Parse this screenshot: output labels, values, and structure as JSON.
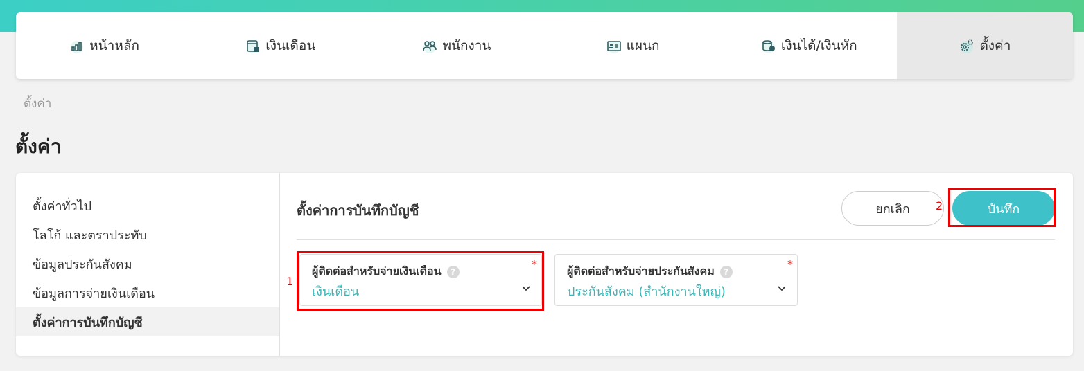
{
  "nav": {
    "items": [
      {
        "label": "หน้าหลัก",
        "icon": "bar-chart-icon"
      },
      {
        "label": "เงินเดือน",
        "icon": "calendar-icon"
      },
      {
        "label": "พนักงาน",
        "icon": "users-icon"
      },
      {
        "label": "แผนก",
        "icon": "id-card-icon"
      },
      {
        "label": "เงินได้/เงินหัก",
        "icon": "money-icon"
      },
      {
        "label": "ตั้งค่า",
        "icon": "gear-icon"
      }
    ]
  },
  "breadcrumb": "ตั้งค่า",
  "page_title": "ตั้งค่า",
  "sidebar": {
    "items": [
      {
        "label": "ตั้งค่าทั่วไป"
      },
      {
        "label": "โลโก้ และตราประทับ"
      },
      {
        "label": "ข้อมูลประกันสังคม"
      },
      {
        "label": "ข้อมูลการจ่ายเงินเดือน"
      },
      {
        "label": "ตั้งค่าการบันทึกบัญชี"
      }
    ]
  },
  "main": {
    "title": "ตั้งค่าการบันทึกบัญชี",
    "cancel_label": "ยกเลิก",
    "save_label": "บันทึก",
    "fields": [
      {
        "label": "ผู้ติดต่อสำหรับจ่ายเงินเดือน",
        "value": "เงินเดือน",
        "required": "*",
        "help": "?"
      },
      {
        "label": "ผู้ติดต่อสำหรับจ่ายประกันสังคม",
        "value": "ประกันสังคม (สำนักงานใหญ่)",
        "required": "*",
        "help": "?"
      }
    ]
  },
  "annotations": {
    "one": "1",
    "two": "2"
  },
  "colors": {
    "accent": "#3ec1c9",
    "highlight": "#ee0000",
    "value_text": "#3ab5b5"
  }
}
